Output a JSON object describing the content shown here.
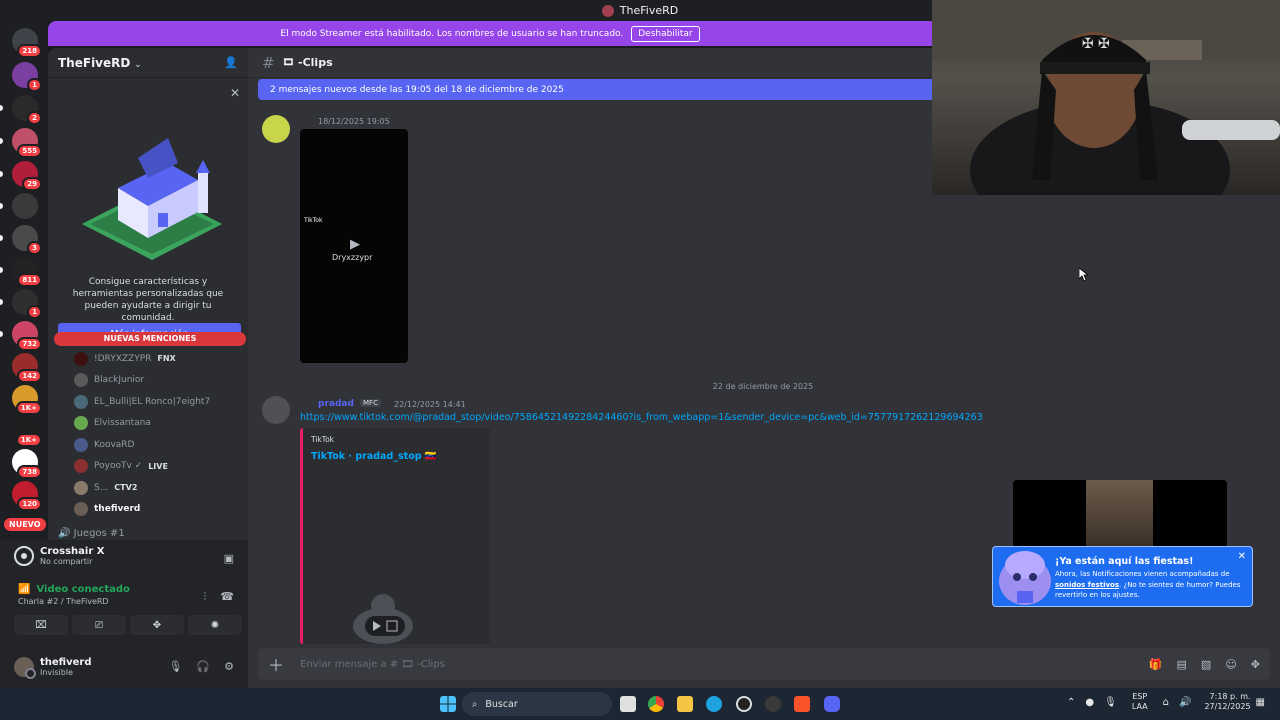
{
  "titlebar": {
    "title": "TheFiveRD"
  },
  "streamer_bar": {
    "message": "El modo Streamer está habilitado. Los nombres de usuario se han truncado.",
    "button": "Deshabilitar"
  },
  "guilds": [
    {
      "badge": "218",
      "color": "#404249"
    },
    {
      "badge": "1",
      "color": "#7a3fa0"
    },
    {
      "badge": "2",
      "color": "#2a2a2a"
    },
    {
      "badge": "555",
      "color": "#c0506a"
    },
    {
      "badge": "29",
      "color": "#b01e3c"
    },
    {
      "badge": "",
      "color": "#3a3a3a"
    },
    {
      "badge": "3",
      "color": "#4a4a4a"
    },
    {
      "badge": "811",
      "color": "#222222"
    },
    {
      "badge": "1",
      "color": "#2f2f2f"
    },
    {
      "badge": "732",
      "color": "#cc4466"
    },
    {
      "badge": "142",
      "color": "#9b2c2c"
    },
    {
      "badge": "1K+",
      "color": "#d89a2a"
    },
    {
      "badge": "1K+",
      "color": "#1e1e1e"
    },
    {
      "badge": "738",
      "color": "#ffffff"
    },
    {
      "badge": "120",
      "color": "#c01e2e"
    }
  ],
  "guild_new_label": "NUEVO",
  "server": {
    "name": "TheFiveRD"
  },
  "promo": {
    "text": "Consigue características y herramientas personalizadas que pueden ayudarte a dirigir tu comunidad.",
    "button": "Más información"
  },
  "mentions_banner": "NUEVAS MENCIONES",
  "members": [
    {
      "name": "!DRYXZZYPR",
      "tag": "FNX",
      "color": "#3a1010"
    },
    {
      "name": "BlackJunior",
      "tag": "",
      "color": "#5a5a5a"
    },
    {
      "name": "EL_Bulli|EL Ronco|7eight7",
      "tag": "",
      "color": "#4a6a7a"
    },
    {
      "name": "Elvissantana",
      "tag": "",
      "color": "#6aa84f"
    },
    {
      "name": "KoovaRD",
      "tag": "",
      "color": "#4a5a8a"
    },
    {
      "name": "PoyooTv ✓",
      "tag": "LIVE",
      "color": "#8a3030"
    },
    {
      "name": "S...",
      "tag": "CTV2",
      "color": "#8a7a6a"
    },
    {
      "name": "thefiverd",
      "tag": "",
      "color": "#6a5e55"
    }
  ],
  "juegos_category": "Juegos #1",
  "voice_panel": {
    "app_name": "Crosshair X",
    "app_sub": "No compartir",
    "status": "Video conectado",
    "channel": "Charla #2 / TheFiveRD"
  },
  "user": {
    "name": "thefiverd",
    "status": "Invisible"
  },
  "channel": {
    "name": "-Clips"
  },
  "new_messages_bar": "2 mensajes nuevos desde las 19:05 del 18 de diciembre de 2025",
  "message1": {
    "timestamp": "18/12/2025 19:05",
    "video_brand": "TikTok",
    "video_watermark": "Dryxzzypr"
  },
  "date_divider": "22 de diciembre de 2025",
  "message2": {
    "author": "pradad",
    "tag": "MFC",
    "timestamp": "22/12/2025 14:41",
    "link": "https://www.tiktok.com/@pradad_stop/video/7586452149228424460?is_from_webapp=1&sender_device=pc&web_id=7577917262129694263",
    "embed_provider": "TikTok",
    "embed_title": "TikTok · pradad_stop 🇻🇪"
  },
  "composer": {
    "placeholder": "Enviar mensaje a # 🎞 -Clips"
  },
  "toast": {
    "title": "¡Ya están aquí las fiestas!",
    "body_pre": "Ahora, las Notificaciones vienen acompañadas de ",
    "body_link": "sonidos festivos",
    "body_post": ". ¿No te sientes de humor? Puedes revertirlo en los ajustes."
  },
  "taskbar": {
    "search_label": "Buscar",
    "lang_top": "ESP",
    "lang_bottom": "LAA",
    "time": "7:18 p. m.",
    "date": "27/12/2025"
  }
}
